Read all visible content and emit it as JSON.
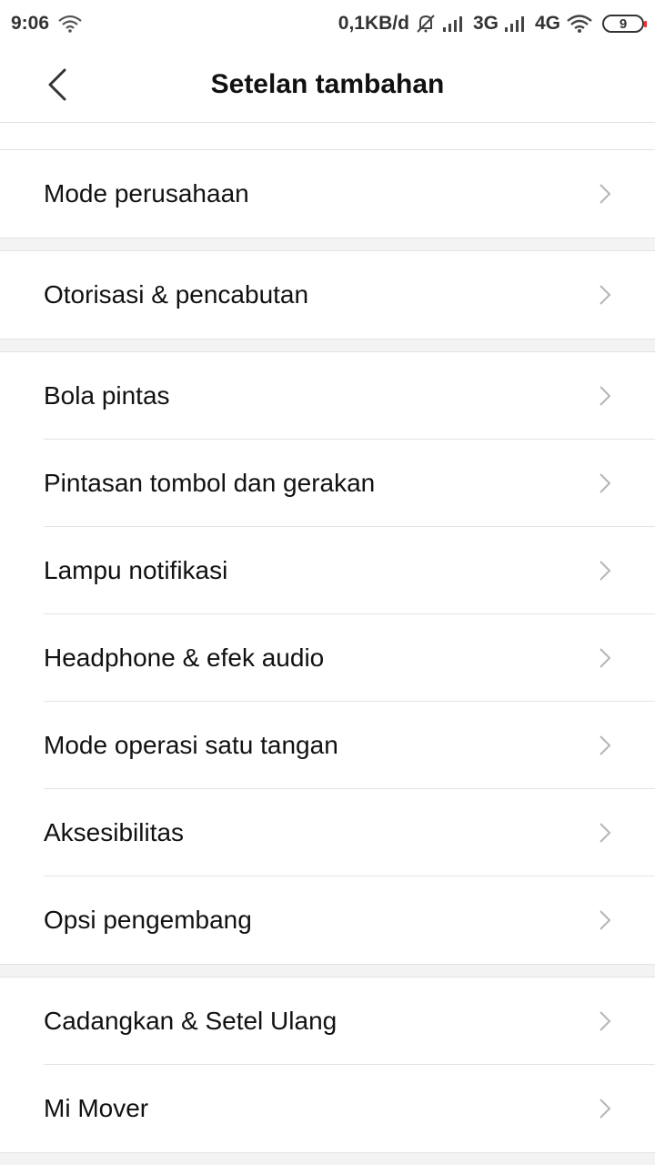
{
  "status_bar": {
    "time": "9:06",
    "speed": "0,1KB/d",
    "net1": "3G",
    "net2": "4G",
    "battery": "9",
    "icons": [
      "wifi-icon",
      "mute-bell-icon",
      "signal-icon",
      "signal-icon",
      "wifi-icon",
      "battery-icon"
    ]
  },
  "header": {
    "title": "Setelan tambahan"
  },
  "sections": [
    {
      "items": [
        {
          "label": "Mode perusahaan"
        }
      ]
    },
    {
      "items": [
        {
          "label": "Otorisasi & pencabutan"
        }
      ]
    },
    {
      "items": [
        {
          "label": "Bola pintas"
        },
        {
          "label": "Pintasan tombol dan gerakan"
        },
        {
          "label": "Lampu notifikasi"
        },
        {
          "label": "Headphone & efek audio"
        },
        {
          "label": "Mode operasi satu tangan"
        },
        {
          "label": "Aksesibilitas"
        },
        {
          "label": "Opsi pengembang"
        }
      ]
    },
    {
      "items": [
        {
          "label": "Cadangkan & Setel Ulang"
        },
        {
          "label": "Mi Mover"
        }
      ]
    }
  ],
  "colors": {
    "divider": "#e4e4e4",
    "section_gap": "#f3f3f3",
    "chevron": "#b5b5b5",
    "battery_low": "#ee3333"
  }
}
